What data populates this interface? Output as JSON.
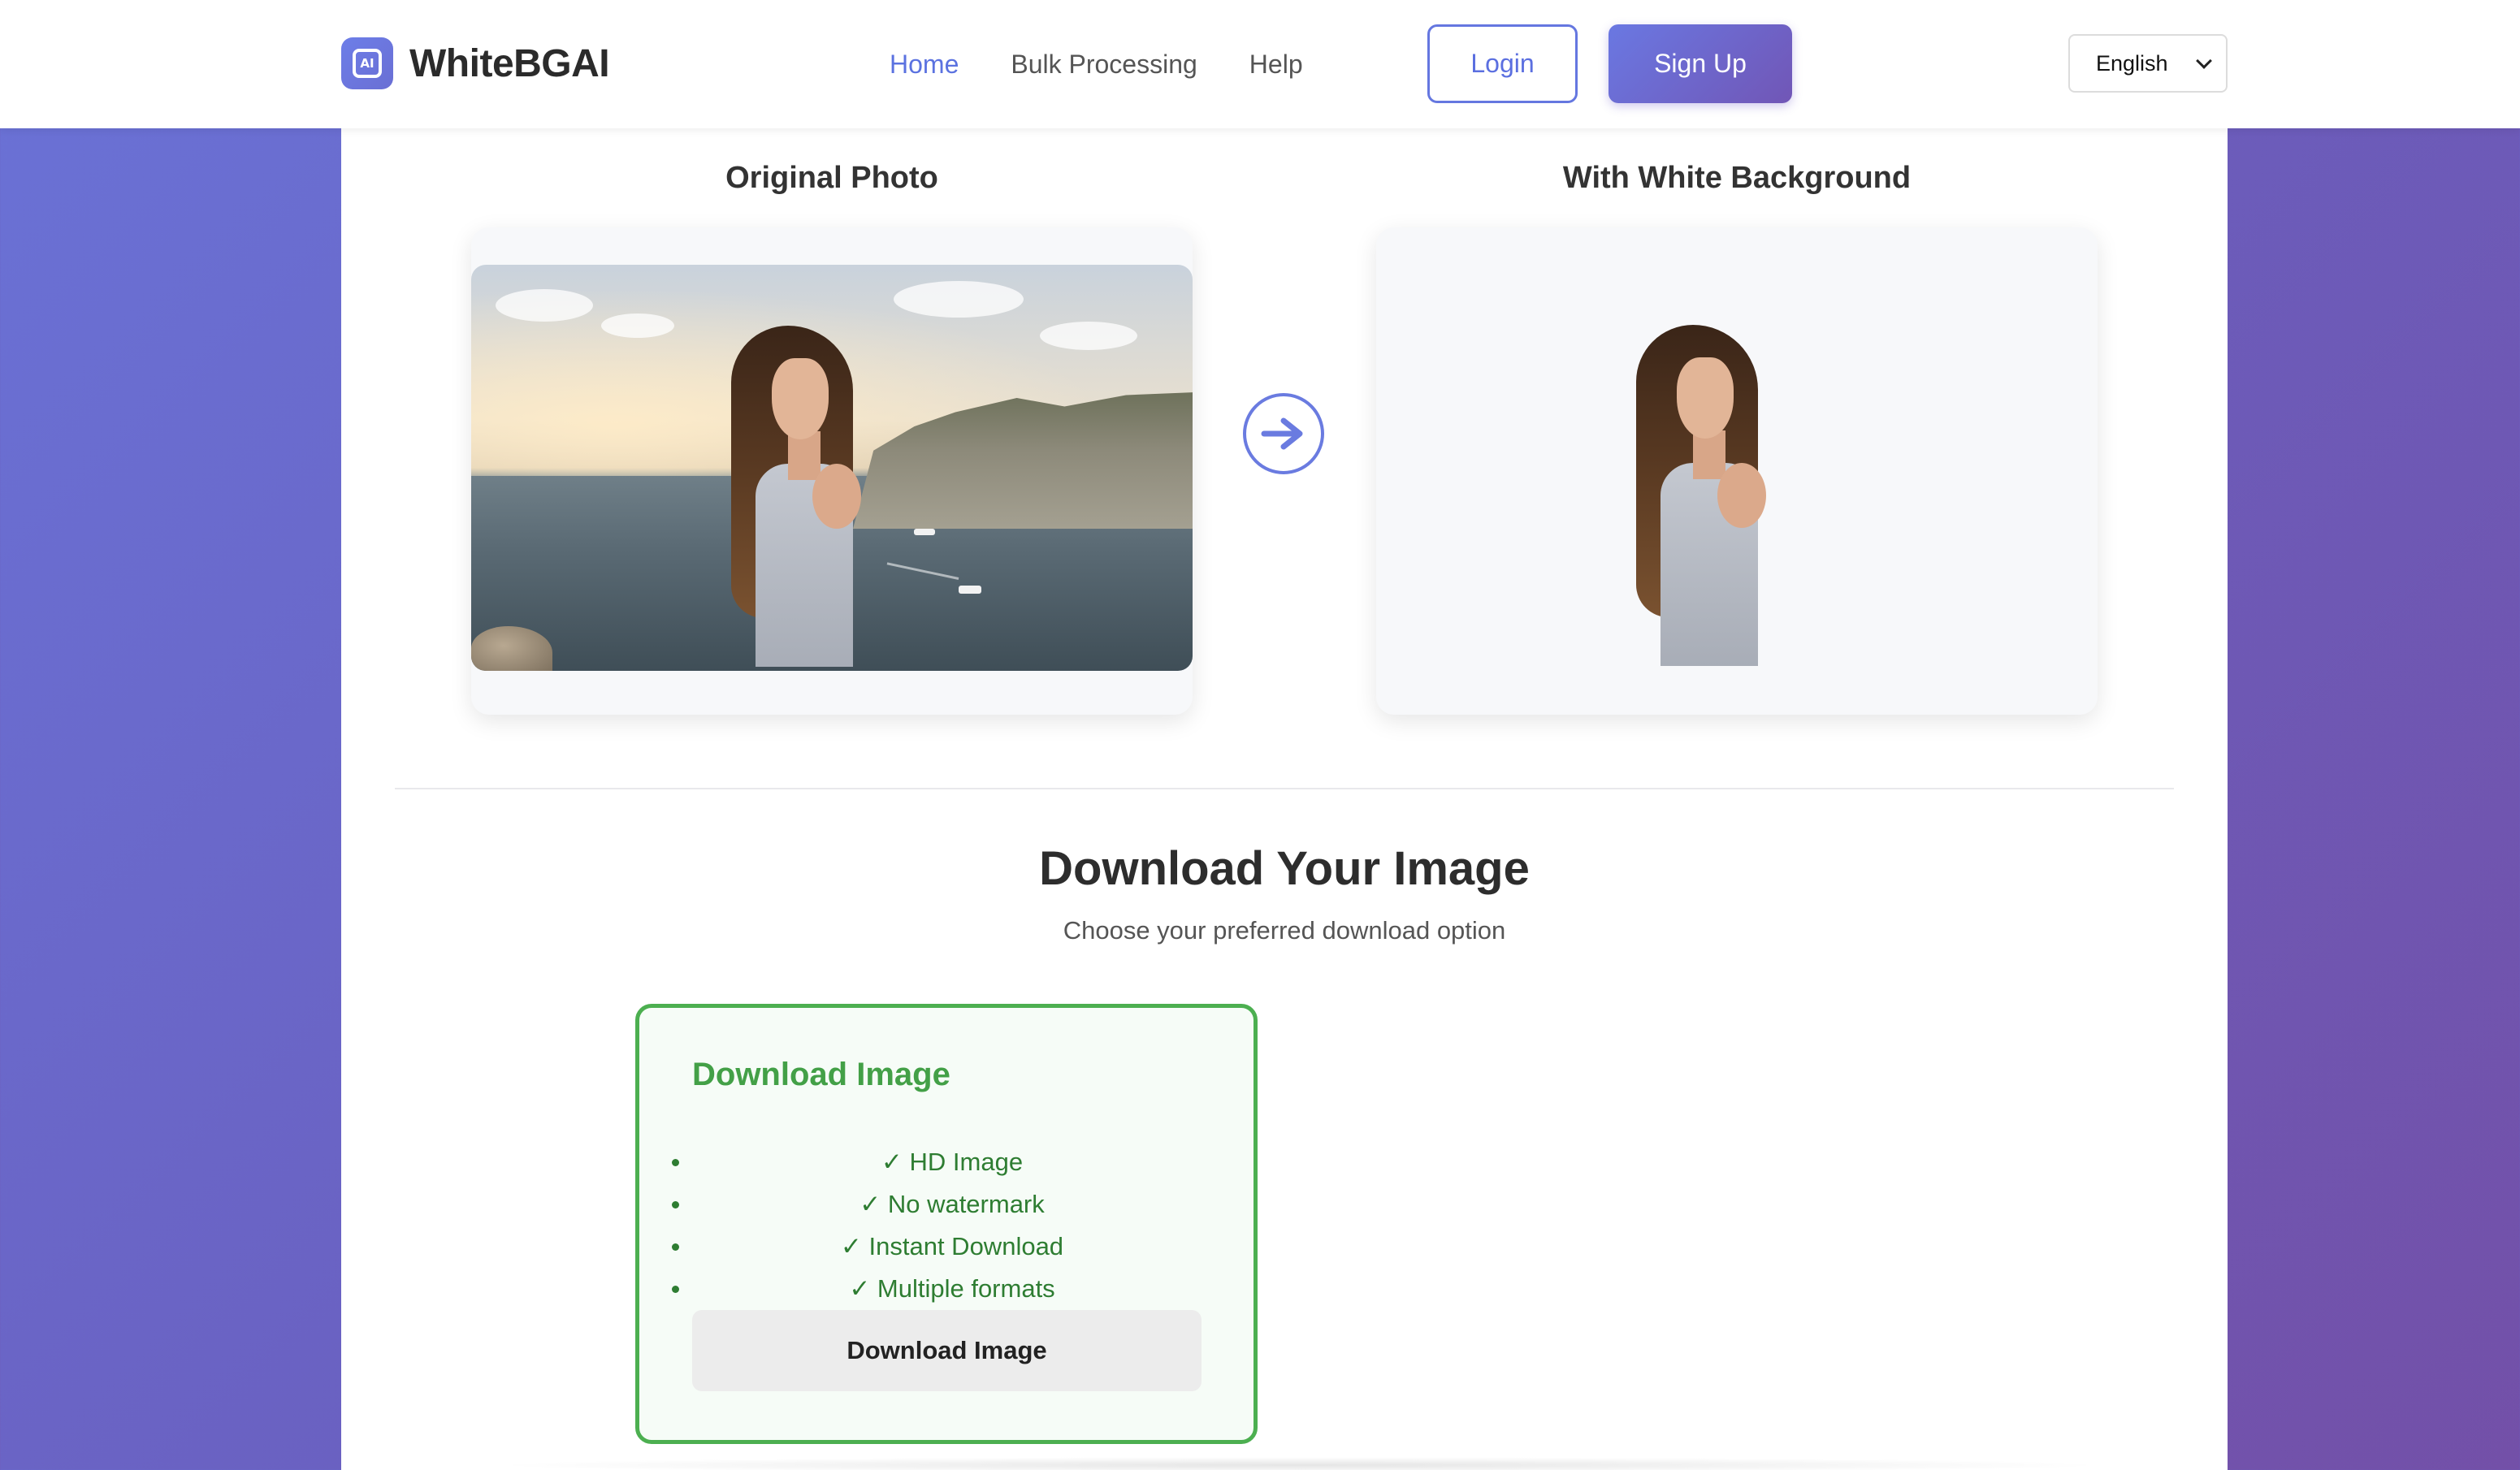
{
  "header": {
    "logo_text": "WhiteBGAI",
    "logo_icon_letters": "AI",
    "nav": {
      "home": "Home",
      "bulk": "Bulk Processing",
      "help": "Help"
    },
    "login_label": "Login",
    "signup_label": "Sign Up",
    "language": "English"
  },
  "comparison": {
    "original_title": "Original Photo",
    "result_title": "With White Background"
  },
  "download": {
    "title": "Download Your Image",
    "subtitle": "Choose your preferred download option",
    "card_title": "Download Image",
    "features": [
      "✓ HD Image",
      "✓ No watermark",
      "✓ Instant Download",
      "✓ Multiple formats"
    ],
    "button_label": "Download Image"
  },
  "colors": {
    "accent": "#5b72e0",
    "success": "#4caf50",
    "success_text": "#2e7d32"
  },
  "icons": {
    "logo": "ai-chip-icon",
    "arrow": "arrow-right-icon",
    "select": "chevron-down-icon"
  }
}
